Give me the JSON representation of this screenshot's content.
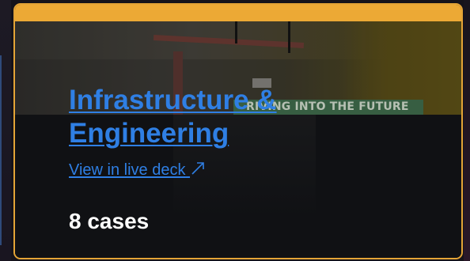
{
  "card": {
    "title": "Infrastructure & Engineering",
    "link_label": "View in live deck",
    "link_icon": "external-link-arrow-icon",
    "count_label": "8 cases",
    "photo_banner_text": "RIVING INTO THE FUTURE"
  },
  "colors": {
    "accent_border": "#e4a436",
    "top_bar": "#eca935",
    "link": "#2f7fe4",
    "panel": "#101114",
    "count_text": "#ffffff"
  }
}
